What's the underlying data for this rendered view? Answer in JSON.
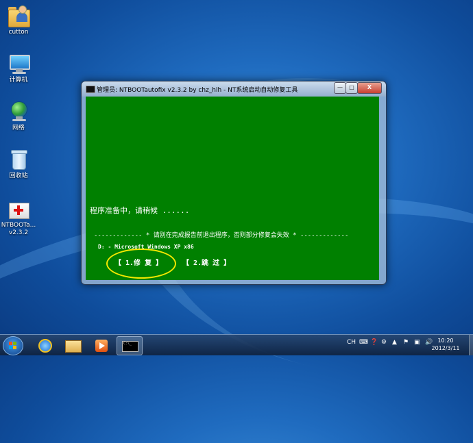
{
  "desktop": {
    "icons": [
      {
        "label": "cutton"
      },
      {
        "label": "计算机"
      },
      {
        "label": "网络"
      },
      {
        "label": "回收站"
      },
      {
        "label": "NTBOOTa...",
        "sublabel": "v2.3.2"
      }
    ]
  },
  "window": {
    "title": "管理员:  NTBOOTautofix v2.3.2 by chz_hlh - NT系统启动自动修复工具",
    "controls": {
      "minimize": "—",
      "maximize": "□",
      "close": "X"
    },
    "console": {
      "status_line": "程序准备中，请稍候 ......",
      "warning_line": "------------- * 请别在完成报告前退出程序，否则部分修复会失效 * -------------",
      "detected_os": "D: - Microsoft Windows XP x86",
      "options": [
        {
          "label": "【 1.修  复 】"
        },
        {
          "label": "【 2.跳  过 】"
        }
      ]
    }
  },
  "annotation": {
    "color": "#f4e800"
  },
  "taskbar": {
    "cmd_preview": "C:\\_",
    "tray": {
      "lang": "CH"
    },
    "clock": {
      "time": "10:20",
      "date": "2012/3/11"
    }
  }
}
